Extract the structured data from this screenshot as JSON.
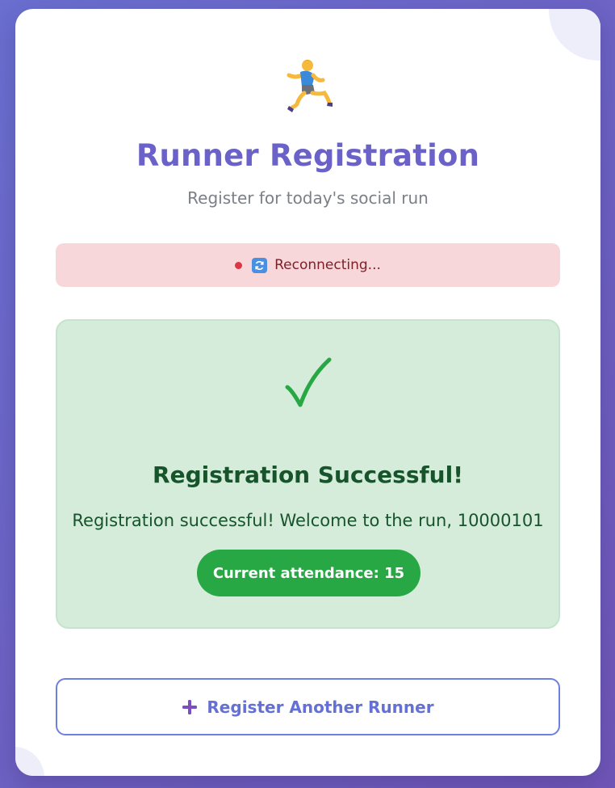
{
  "header": {
    "title": "Runner Registration",
    "subtitle": "Register for today's social run",
    "icon": "runner-icon"
  },
  "status": {
    "text": "Reconnecting...",
    "dot_color": "#dc3545",
    "icon": "refresh-icon"
  },
  "success": {
    "icon": "checkmark-icon",
    "title": "Registration Successful!",
    "message": "Registration successful! Welcome to the run, 10000101",
    "attendance_label": "Current attendance: 15"
  },
  "actions": {
    "register_another_label": "Register Another Runner",
    "register_another_icon": "plus-icon"
  },
  "colors": {
    "accent": "#6a62c8",
    "success": "#28a745",
    "success_bg": "#d5ecda",
    "error_bg": "#f8d7da"
  }
}
